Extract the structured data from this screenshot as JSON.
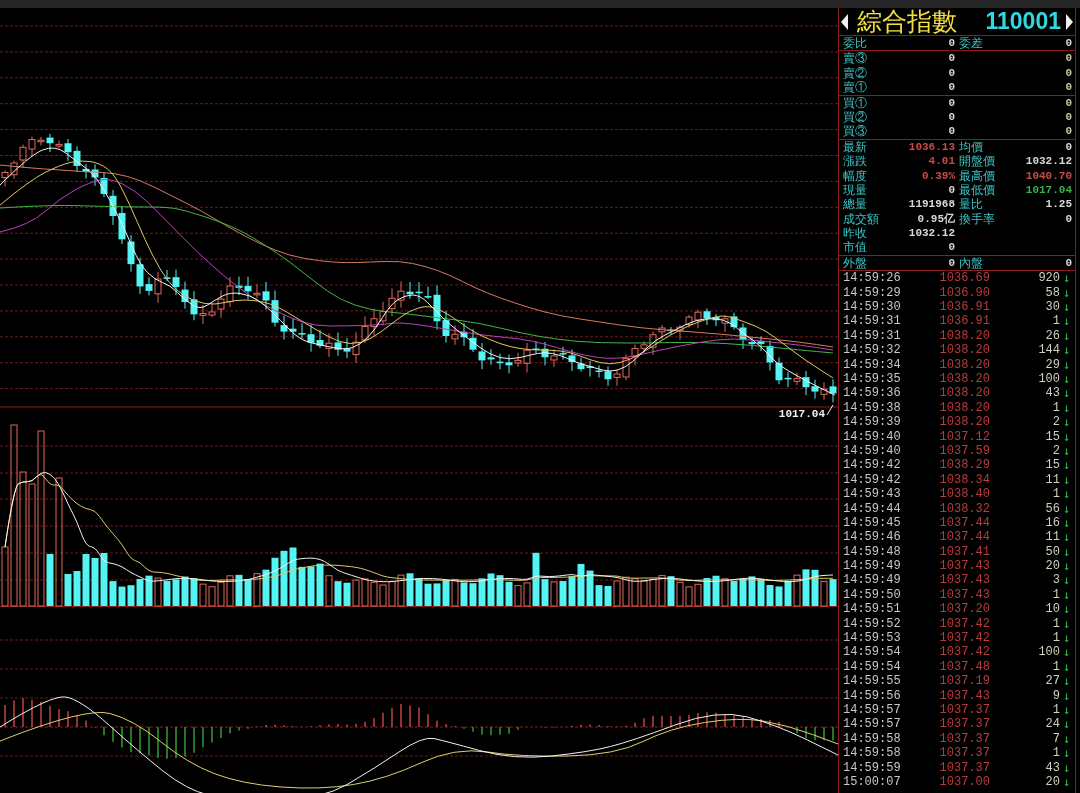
{
  "header": {
    "name": "綜合指數",
    "code": "110001"
  },
  "order_ratio": [
    {
      "label": "委比",
      "value": "0"
    },
    {
      "label": "委差",
      "value": "0"
    }
  ],
  "asks": [
    {
      "label": "賣③",
      "price": "0",
      "volume": "0"
    },
    {
      "label": "賣②",
      "price": "0",
      "volume": "0"
    },
    {
      "label": "賣①",
      "price": "0",
      "volume": "0"
    }
  ],
  "bids": [
    {
      "label": "買①",
      "price": "0",
      "volume": "0"
    },
    {
      "label": "買②",
      "price": "0",
      "volume": "0"
    },
    {
      "label": "買③",
      "price": "0",
      "volume": "0"
    }
  ],
  "quote": [
    [
      {
        "label": "最新",
        "value": "1036.13",
        "color": "#c84a4a"
      },
      {
        "label": "均價",
        "value": "0",
        "color": "#d8d8d8"
      }
    ],
    [
      {
        "label": "漲跌",
        "value": "4.01",
        "color": "#c84a4a"
      },
      {
        "label": "開盤價",
        "value": "1032.12",
        "color": "#d8d8d8"
      }
    ],
    [
      {
        "label": "幅度",
        "value": "0.39%",
        "color": "#c84a4a"
      },
      {
        "label": "最高價",
        "value": "1040.70",
        "color": "#c84a4a"
      }
    ],
    [
      {
        "label": "現量",
        "value": "0",
        "color": "#d8d8d8"
      },
      {
        "label": "最低價",
        "value": "1017.04",
        "color": "#3cb04a"
      }
    ],
    [
      {
        "label": "總量",
        "value": "1191968",
        "color": "#d8d8d8"
      },
      {
        "label": "量比",
        "value": "1.25",
        "color": "#d8d8d8"
      }
    ],
    [
      {
        "label": "成交額",
        "value": "0.95亿",
        "color": "#d8d8d8"
      },
      {
        "label": "換手率",
        "value": "0",
        "color": "#d8d8d8"
      }
    ],
    [
      {
        "label": "昨收",
        "value": "1032.12",
        "color": "#d8d8d8"
      }
    ],
    [
      {
        "label": "市值",
        "value": "0",
        "color": "#d8d8d8"
      }
    ]
  ],
  "volume_split": [
    {
      "label": "外盤",
      "value": "0"
    },
    {
      "label": "內盤",
      "value": "0"
    }
  ],
  "trades": [
    {
      "time": "14:59:26",
      "price": "1036.69",
      "volume": "920",
      "arrow": "↓"
    },
    {
      "time": "14:59:29",
      "price": "1036.90",
      "volume": "58",
      "arrow": "↓"
    },
    {
      "time": "14:59:30",
      "price": "1036.91",
      "volume": "30",
      "arrow": "↓"
    },
    {
      "time": "14:59:31",
      "price": "1036.91",
      "volume": "1",
      "arrow": "↓"
    },
    {
      "time": "14:59:31",
      "price": "1038.20",
      "volume": "26",
      "arrow": "↓"
    },
    {
      "time": "14:59:32",
      "price": "1038.20",
      "volume": "144",
      "arrow": "↓"
    },
    {
      "time": "14:59:34",
      "price": "1038.20",
      "volume": "29",
      "arrow": "↓"
    },
    {
      "time": "14:59:35",
      "price": "1038.20",
      "volume": "100",
      "arrow": "↓"
    },
    {
      "time": "14:59:36",
      "price": "1038.20",
      "volume": "43",
      "arrow": "↓"
    },
    {
      "time": "14:59:38",
      "price": "1038.20",
      "volume": "1",
      "arrow": "↓"
    },
    {
      "time": "14:59:39",
      "price": "1038.20",
      "volume": "2",
      "arrow": "↓"
    },
    {
      "time": "14:59:40",
      "price": "1037.12",
      "volume": "15",
      "arrow": "↓"
    },
    {
      "time": "14:59:40",
      "price": "1037.59",
      "volume": "2",
      "arrow": "↓"
    },
    {
      "time": "14:59:42",
      "price": "1038.29",
      "volume": "15",
      "arrow": "↓"
    },
    {
      "time": "14:59:42",
      "price": "1038.34",
      "volume": "11",
      "arrow": "↓"
    },
    {
      "time": "14:59:43",
      "price": "1038.40",
      "volume": "1",
      "arrow": "↓"
    },
    {
      "time": "14:59:44",
      "price": "1038.32",
      "volume": "56",
      "arrow": "↓"
    },
    {
      "time": "14:59:45",
      "price": "1037.44",
      "volume": "16",
      "arrow": "↓"
    },
    {
      "time": "14:59:46",
      "price": "1037.44",
      "volume": "11",
      "arrow": "↓"
    },
    {
      "time": "14:59:48",
      "price": "1037.41",
      "volume": "50",
      "arrow": "↓"
    },
    {
      "time": "14:59:49",
      "price": "1037.43",
      "volume": "20",
      "arrow": "↓"
    },
    {
      "time": "14:59:49",
      "price": "1037.43",
      "volume": "3",
      "arrow": "↓"
    },
    {
      "time": "14:59:50",
      "price": "1037.43",
      "volume": "1",
      "arrow": "↓"
    },
    {
      "time": "14:59:51",
      "price": "1037.20",
      "volume": "10",
      "arrow": "↓"
    },
    {
      "time": "14:59:52",
      "price": "1037.42",
      "volume": "1",
      "arrow": "↓"
    },
    {
      "time": "14:59:53",
      "price": "1037.42",
      "volume": "1",
      "arrow": "↓"
    },
    {
      "time": "14:59:54",
      "price": "1037.42",
      "volume": "100",
      "arrow": "↓"
    },
    {
      "time": "14:59:54",
      "price": "1037.48",
      "volume": "1",
      "arrow": "↓"
    },
    {
      "time": "14:59:55",
      "price": "1037.19",
      "volume": "27",
      "arrow": "↓"
    },
    {
      "time": "14:59:56",
      "price": "1037.43",
      "volume": "9",
      "arrow": "↓"
    },
    {
      "time": "14:59:57",
      "price": "1037.37",
      "volume": "1",
      "arrow": "↓"
    },
    {
      "time": "14:59:57",
      "price": "1037.37",
      "volume": "24",
      "arrow": "↓"
    },
    {
      "time": "14:59:58",
      "price": "1037.37",
      "volume": "7",
      "arrow": "↓"
    },
    {
      "time": "14:59:58",
      "price": "1037.37",
      "volume": "1",
      "arrow": "↓"
    },
    {
      "time": "14:59:59",
      "price": "1037.37",
      "volume": "43",
      "arrow": "↓"
    },
    {
      "time": "15:00:07",
      "price": "1037.00",
      "volume": "20",
      "arrow": "↓"
    }
  ],
  "chart": {
    "low_marker": "1017.04"
  }
}
